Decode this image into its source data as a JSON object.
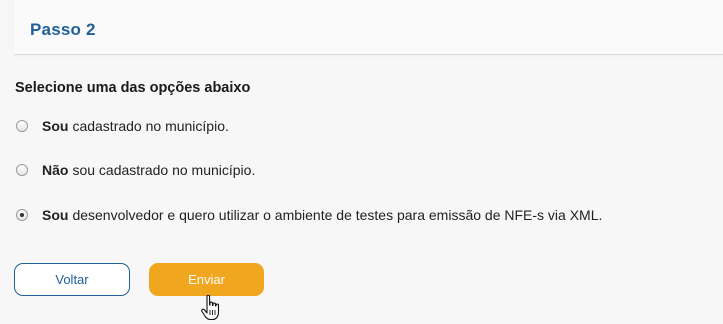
{
  "header": {
    "step_title": "Passo 2"
  },
  "form": {
    "question": "Selecione uma das opções abaixo",
    "options": [
      {
        "bold": "Sou",
        "text": "cadastrado no município.",
        "checked": false
      },
      {
        "bold": "Não",
        "text": "sou cadastrado no município.",
        "checked": false
      },
      {
        "bold": "Sou",
        "text": "desenvolvedor e quero utilizar o ambiente de testes para emissão de NFE-s via XML.",
        "checked": true
      }
    ]
  },
  "buttons": {
    "back_label": "Voltar",
    "send_label": "Enviar"
  },
  "colors": {
    "title": "#1f5f9a",
    "send_button": "#f0a61f",
    "back_border": "#1f5f9a"
  },
  "icons": {
    "cursor": "hand-pointer-icon"
  }
}
